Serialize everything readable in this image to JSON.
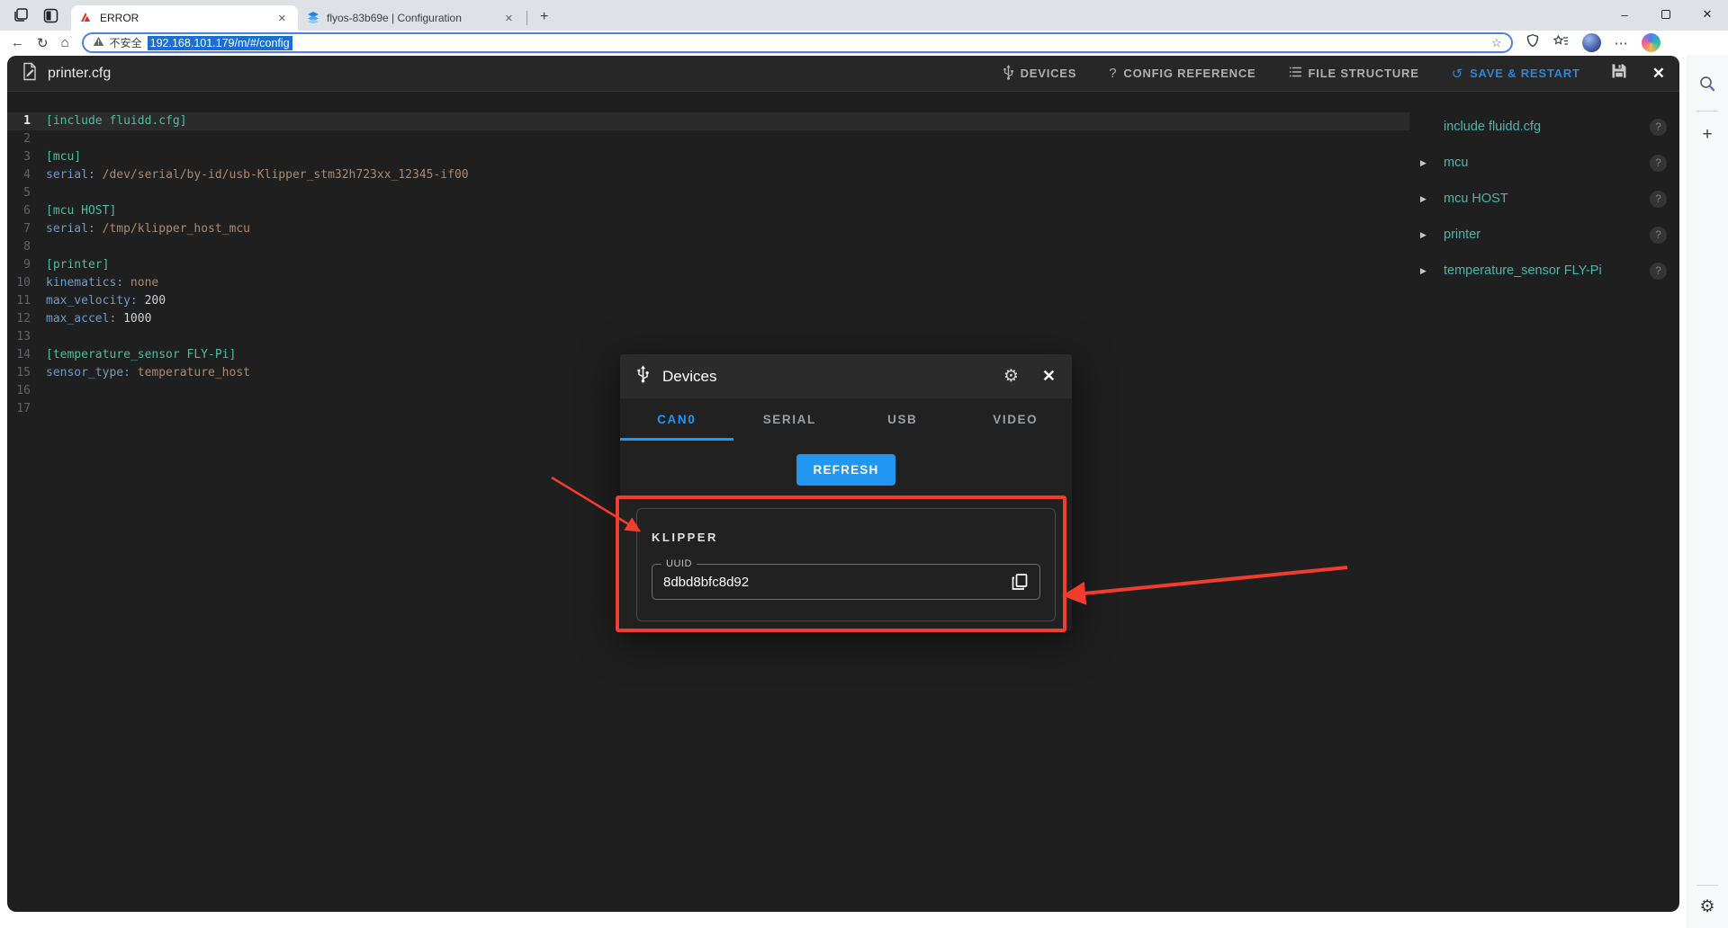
{
  "browser": {
    "tabs": [
      {
        "title": "ERROR"
      },
      {
        "title": "flyos-83b69e | Configuration"
      }
    ],
    "address": {
      "security_label": "不安全",
      "url": "192.168.101.179/m/#/config"
    }
  },
  "editor": {
    "title": "printer.cfg",
    "toolbar": {
      "devices": "DEVICES",
      "config_reference": "CONFIG REFERENCE",
      "file_structure": "FILE STRUCTURE",
      "save_restart": "SAVE & RESTART"
    },
    "lines": [
      {
        "n": 1,
        "active": true,
        "seg": [
          {
            "c": "sec",
            "t": "[include fluidd.cfg]"
          }
        ]
      },
      {
        "n": 2,
        "seg": []
      },
      {
        "n": 3,
        "seg": [
          {
            "c": "sec",
            "t": "[mcu]"
          }
        ]
      },
      {
        "n": 4,
        "seg": [
          {
            "c": "key",
            "t": "serial: "
          },
          {
            "c": "str",
            "t": "/dev/serial/by-id/usb-Klipper_stm32h723xx_12345-if00"
          }
        ]
      },
      {
        "n": 5,
        "seg": []
      },
      {
        "n": 6,
        "seg": [
          {
            "c": "sec",
            "t": "[mcu HOST]"
          }
        ]
      },
      {
        "n": 7,
        "seg": [
          {
            "c": "key",
            "t": "serial: "
          },
          {
            "c": "str",
            "t": "/tmp/klipper_host_mcu"
          }
        ]
      },
      {
        "n": 8,
        "seg": []
      },
      {
        "n": 9,
        "seg": [
          {
            "c": "sec",
            "t": "[printer]"
          }
        ]
      },
      {
        "n": 10,
        "seg": [
          {
            "c": "key",
            "t": "kinematics: "
          },
          {
            "c": "str",
            "t": "none"
          }
        ]
      },
      {
        "n": 11,
        "seg": [
          {
            "c": "key",
            "t": "max_velocity: "
          },
          {
            "c": "num",
            "t": "200"
          }
        ]
      },
      {
        "n": 12,
        "seg": [
          {
            "c": "key",
            "t": "max_accel: "
          },
          {
            "c": "num",
            "t": "1000"
          }
        ]
      },
      {
        "n": 13,
        "seg": []
      },
      {
        "n": 14,
        "seg": [
          {
            "c": "sec",
            "t": "[temperature_sensor FLY-Pi]"
          }
        ]
      },
      {
        "n": 15,
        "seg": [
          {
            "c": "key",
            "t": "sensor_type: "
          },
          {
            "c": "str",
            "t": "temperature_host"
          }
        ]
      },
      {
        "n": 16,
        "seg": []
      },
      {
        "n": 17,
        "seg": []
      }
    ],
    "tree": [
      {
        "label": "include fluidd.cfg",
        "arrow": ""
      },
      {
        "label": "mcu",
        "arrow": "▶"
      },
      {
        "label": "mcu HOST",
        "arrow": "▶"
      },
      {
        "label": "printer",
        "arrow": "▶"
      },
      {
        "label": "temperature_sensor FLY-Pi",
        "arrow": "▶"
      }
    ]
  },
  "modal": {
    "title": "Devices",
    "tabs": [
      "CAN0",
      "SERIAL",
      "USB",
      "VIDEO"
    ],
    "active_tab": "CAN0",
    "refresh_label": "REFRESH",
    "device": {
      "name": "KLIPPER",
      "uuid_label": "UUID",
      "uuid": "8dbd8bfc8d92"
    }
  },
  "icons": {
    "minimize": "–",
    "close": "✕",
    "back": "←",
    "refresh": "↻",
    "home": "⌂",
    "star": "☆",
    "ellipsis": "⋯",
    "plus": "+",
    "new_tab": "+",
    "gear": "⚙",
    "help": "?",
    "restart": "↺",
    "question": "?"
  },
  "colors": {
    "accent": "#2196f3",
    "tree_text": "#4db6ac",
    "annotation_red": "#f23c2e",
    "url_selection": "#1b6fd0"
  }
}
